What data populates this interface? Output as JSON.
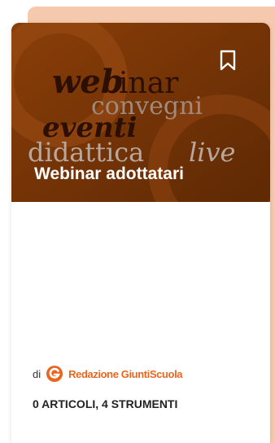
{
  "card": {
    "cover": {
      "word_web": "web",
      "word_inar": "inar",
      "word_convegni": "convegni",
      "word_eventi": "eventi",
      "word_didattica": "didattica",
      "word_live": "live"
    },
    "title": "Webinar adottatari",
    "bookmark_icon": "bookmark-icon",
    "author": {
      "prefix": "di",
      "org": "Redazione GiuntiScuola",
      "logo_icon": "giunti-logo-icon"
    },
    "counts": "0 ARTICOLI, 4 STRUMENTI"
  },
  "colors": {
    "accent_orange": "#e8661f",
    "cover_brown": "#7a3606",
    "stack_peach": "#f5c9ad"
  }
}
